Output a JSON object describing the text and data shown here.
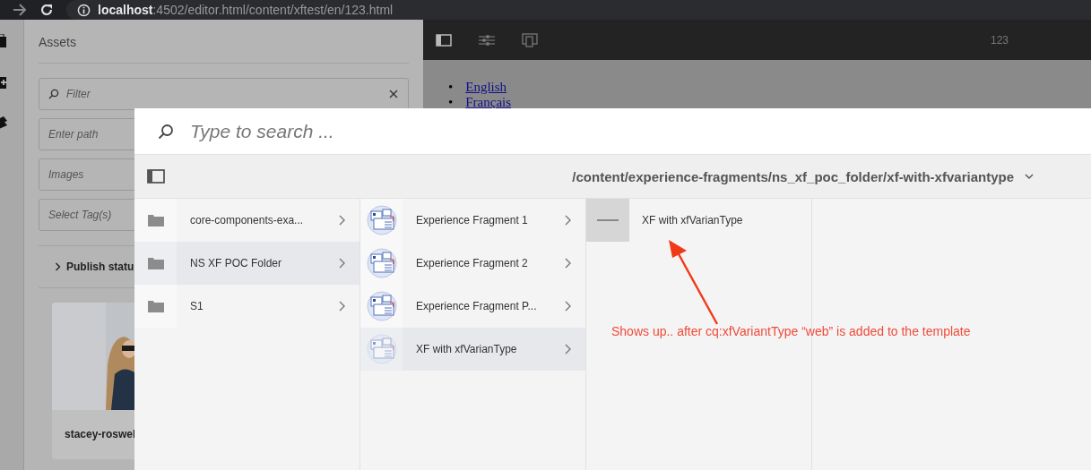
{
  "browser": {
    "host": "localhost",
    "path": ":4502/editor.html/content/xftest/en/123.html"
  },
  "assets_panel": {
    "title": "Assets",
    "filter": {
      "placeholder": "Filter"
    },
    "path_field": {
      "placeholder": "Enter path"
    },
    "type_field": {
      "placeholder": "Images"
    },
    "tags_field": {
      "placeholder": "Select Tag(s)"
    },
    "publish_status": {
      "label": "Publish statu",
      "expanded": false
    },
    "asset_card": {
      "name": "stacey-roswel"
    }
  },
  "editor": {
    "page_title": "123",
    "links": [
      {
        "bullet": "•",
        "label": "English"
      },
      {
        "bullet": "•",
        "label": "Français"
      }
    ]
  },
  "picker": {
    "search": {
      "placeholder": "Type to search ..."
    },
    "path": "/content/experience-fragments/ns_xf_poc_folder/xf-with-xfvariantype",
    "columns": [
      {
        "items": [
          {
            "label": "core-components-exa...",
            "kind": "folder",
            "selected": false
          },
          {
            "label": "NS XF POC Folder",
            "kind": "folder",
            "selected": true
          },
          {
            "label": "S1",
            "kind": "folder",
            "selected": false
          }
        ]
      },
      {
        "items": [
          {
            "label": "Experience Fragment 1",
            "kind": "fragment",
            "selected": false
          },
          {
            "label": "Experience Fragment 2",
            "kind": "fragment",
            "selected": false
          },
          {
            "label": "Experience Fragment P...",
            "kind": "fragment",
            "selected": false
          },
          {
            "label": "XF with xfVarianType",
            "kind": "fragment",
            "selected": true
          }
        ]
      }
    ],
    "preview": {
      "title": "XF with xfVarianType"
    }
  },
  "annotation": {
    "text": "Shows up.. after cq:xfVariantType “web” is added to the template"
  }
}
